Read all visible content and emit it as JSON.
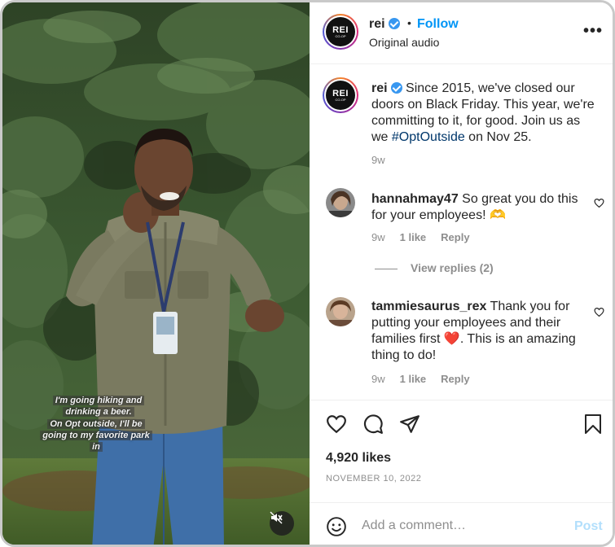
{
  "post": {
    "username": "rei",
    "follow_label": "Follow",
    "separator": "•",
    "audio_label": "Original audio",
    "more_label": "•••",
    "logo_text": "REI",
    "logo_sub": "CO-OP"
  },
  "caption": {
    "username": "rei",
    "text_before": " Since 2015, we've closed our doors on Black Friday. This year, we're committing to it, for good. Join us as we ",
    "hashtag": "#OptOutside",
    "text_after": " on Nov 25.",
    "time": "9w"
  },
  "comments": [
    {
      "username": "hannahmay47",
      "text": " So great you do this for your employees! 🫶",
      "time": "9w",
      "likes": "1 like",
      "reply_label": "Reply"
    },
    {
      "username": "tammiesaurus_rex",
      "text_before": " Thank you for putting your employees and their families first ",
      "emoji": "❤️",
      "text_after": ". This is an amazing thing to do!",
      "time": "9w",
      "likes": "1 like",
      "reply_label": "Reply"
    }
  ],
  "view_replies": "View replies (2)",
  "video": {
    "caption_line1": "I'm going hiking and",
    "caption_line2": "drinking a beer.",
    "caption_line3": "On Opt outside, I'll be",
    "caption_line4": "going to my favorite park",
    "caption_line5": "in"
  },
  "stats": {
    "likes": "4,920 likes",
    "date": "NOVEMBER 10, 2022"
  },
  "add_comment": {
    "placeholder": "Add a comment…",
    "post_label": "Post"
  },
  "colors": {
    "accent": "#0095f6",
    "verified": "#3897f0",
    "muted": "#8e8e8e",
    "hashtag": "#00376b",
    "post_disabled": "#b2dffc"
  },
  "icons": [
    "verified-icon",
    "more-icon",
    "heart-icon",
    "comment-icon",
    "share-icon",
    "bookmark-icon",
    "smiley-icon",
    "mute-icon"
  ]
}
